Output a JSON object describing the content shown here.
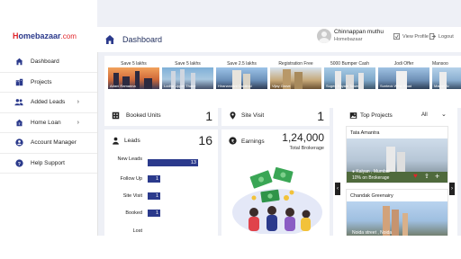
{
  "brand": {
    "logo_h": "H",
    "logo_rest": "omebazaar",
    "logo_com": ".com"
  },
  "header": {
    "title": "Dashboard",
    "user_name": "Chinnappan muthu",
    "user_org": "Homebazaar",
    "view_profile": "View Profile",
    "logout": "Logout"
  },
  "sidebar": {
    "items": [
      {
        "label": "Dashboard",
        "icon": "home-icon"
      },
      {
        "label": "Projects",
        "icon": "building-icon"
      },
      {
        "label": "Added Leads",
        "icon": "users-icon"
      },
      {
        "label": "Home Loan",
        "icon": "house-rupee-icon"
      },
      {
        "label": "Account Manager",
        "icon": "user-circle-icon"
      },
      {
        "label": "Help Support",
        "icon": "help-icon"
      }
    ]
  },
  "offers": [
    {
      "label": "Save 5 lakhs",
      "caption": "Adani Ramanna"
    },
    {
      "label": "Save 5 lakhs",
      "caption": "Lodha Upper Thane"
    },
    {
      "label": "Save 2.5 lakhs",
      "caption": "Hiranandani Cardinal"
    },
    {
      "label": "Registration Free",
      "caption": "Vijay Grove"
    },
    {
      "label": "5000 Bumper Cash",
      "caption": "Sugee Royale Tower"
    },
    {
      "label": "Jodi Offer",
      "caption": "Sunteck West Road"
    },
    {
      "label": "Mansoo",
      "caption": "Marvel Ar"
    }
  ],
  "stats": {
    "booked_units": {
      "label": "Booked Units",
      "value": "1"
    },
    "site_visit": {
      "label": "Site Visit",
      "value": "1"
    },
    "leads": {
      "label": "Leads",
      "value": "16"
    },
    "earnings": {
      "label": "Earnings",
      "value": "1,24,000",
      "sub": "Total Brokerage"
    }
  },
  "leads_breakdown": [
    {
      "label": "New Leads",
      "value": "13",
      "fraction": 0.8
    },
    {
      "label": "Follow Up",
      "value": "1",
      "fraction": 0.1
    },
    {
      "label": "Site Visit",
      "value": "1",
      "fraction": 0.1
    },
    {
      "label": "Booked",
      "value": "1",
      "fraction": 0.1
    },
    {
      "label": "Lost",
      "value": "",
      "fraction": 0
    }
  ],
  "top_projects": {
    "title": "Top Projects",
    "filter": "All",
    "items": [
      {
        "name": "Tata Amantra",
        "location": "Kalyan , Mumbai",
        "brokerage": "10% on Brokerage"
      },
      {
        "name": "Chandak Greenairy",
        "location": "Noida street , Noida",
        "brokerage": ""
      }
    ]
  },
  "colors": {
    "brand_blue": "#2b3a8c",
    "brand_red": "#e1252b",
    "money_green": "#3aa655"
  }
}
